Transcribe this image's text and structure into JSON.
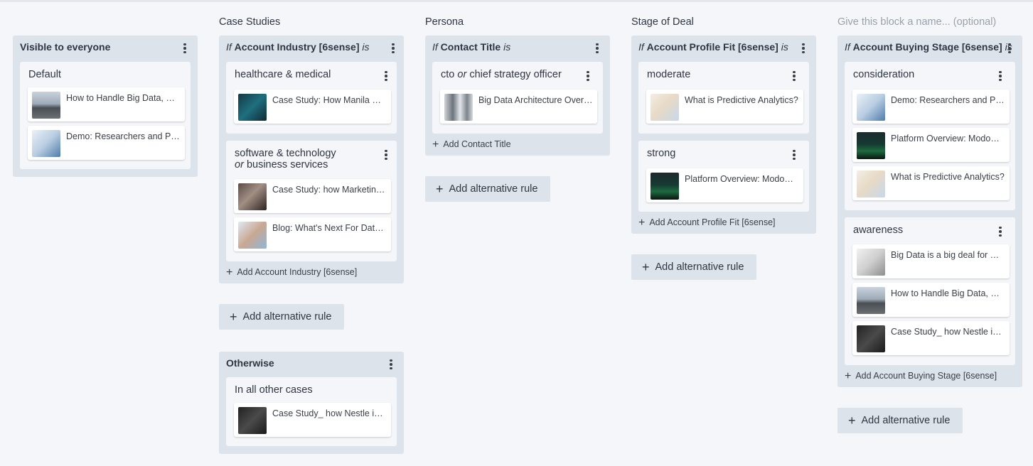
{
  "columns": {
    "c1": {
      "panel": {
        "title": "Visible to everyone",
        "groups": [
          {
            "name": "Default",
            "cards": [
              "How to Handle Big Data, Before It Handles You",
              "Demo: Researchers and Physicians"
            ]
          }
        ]
      }
    },
    "c2": {
      "title": "Case Studies",
      "panel": {
        "if_word": "If",
        "field": "Account Industry [6sense]",
        "is_word": "is",
        "groups": [
          {
            "name": "healthcare & medical",
            "cards": [
              "Case Study: How Manila Health"
            ]
          },
          {
            "name_line1": "software & technology",
            "or_word": "or",
            "name_line2": "business services",
            "cards": [
              "Case Study: how Marketing Teams",
              "Blog: What's Next For Data and AI"
            ]
          }
        ],
        "add_label": "Add Account Industry [6sense]"
      },
      "alt_rule": "Add alternative rule",
      "otherwise": {
        "title": "Otherwise",
        "group": "In all other cases",
        "cards": [
          "Case Study_ how Nestle is Managing Data"
        ]
      }
    },
    "c3": {
      "title": "Persona",
      "panel": {
        "if_word": "If",
        "field": "Contact Title",
        "is_word": "is",
        "groups": [
          {
            "name_a": "cto",
            "or_word": "or",
            "name_b": "chief strategy officer",
            "cards": [
              "Big Data Architecture Overview"
            ]
          }
        ],
        "add_label": "Add Contact Title"
      },
      "alt_rule": "Add alternative rule"
    },
    "c4": {
      "title": "Stage of Deal",
      "panel": {
        "if_word": "If",
        "field": "Account Profile Fit [6sense]",
        "is_word": "is",
        "groups": [
          {
            "name": "moderate",
            "cards": [
              "What is Predictive Analytics?"
            ]
          },
          {
            "name": "strong",
            "cards": [
              "Platform Overview: ModoMind"
            ]
          }
        ],
        "add_label": "Add Account Profile Fit [6sense]"
      },
      "alt_rule": "Add alternative rule"
    },
    "c5": {
      "title_placeholder": "Give this block a name... (optional)",
      "panel": {
        "if_word": "If",
        "field": "Account Buying Stage [6sense]",
        "is_word": "is",
        "groups": [
          {
            "name": "consideration",
            "cards": [
              "Demo: Researchers and Physicians",
              "Platform Overview: ModoMind",
              "What is Predictive Analytics?"
            ]
          },
          {
            "name": "awareness",
            "cards": [
              "Big Data is a big deal for marketing",
              "How to Handle Big Data, Before It Handles You",
              "Case Study_ how Nestle is Managing Data"
            ]
          }
        ],
        "add_label": "Add Account Buying Stage [6sense]"
      },
      "alt_rule": "Add alternative rule"
    }
  },
  "icons": {
    "menu": "vertical-dots-icon",
    "add": "plus-icon"
  },
  "colors": {
    "page_bg": "#f4f6fa",
    "panel_bg": "#dde3ea",
    "card_bg": "#ffffff",
    "placeholder": "#9aa1ab"
  }
}
